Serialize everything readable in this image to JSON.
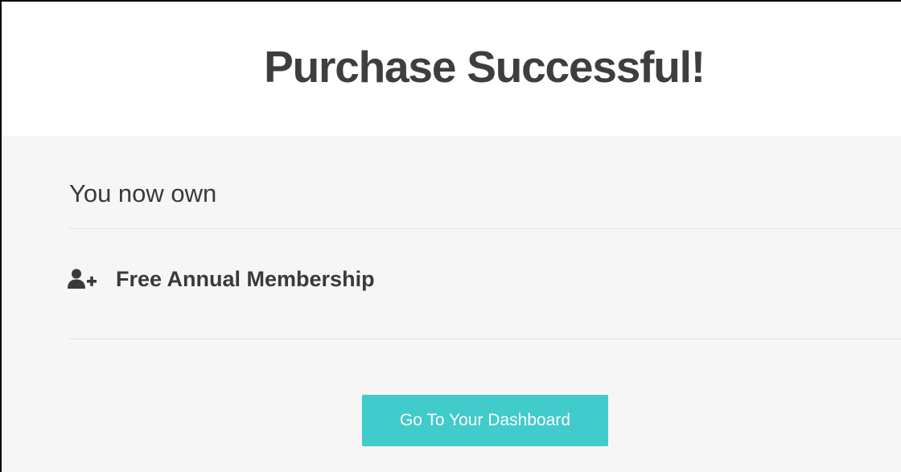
{
  "header": {
    "title": "Purchase Successful!"
  },
  "owned": {
    "heading": "You now own",
    "items": [
      {
        "icon": "user-plus-icon",
        "label": "Free Annual Membership"
      }
    ]
  },
  "actions": {
    "dashboard_label": "Go To Your Dashboard"
  },
  "colors": {
    "button_bg": "#41cbcb",
    "panel_bg": "#f6f6f6",
    "text": "#3a3a3a"
  }
}
